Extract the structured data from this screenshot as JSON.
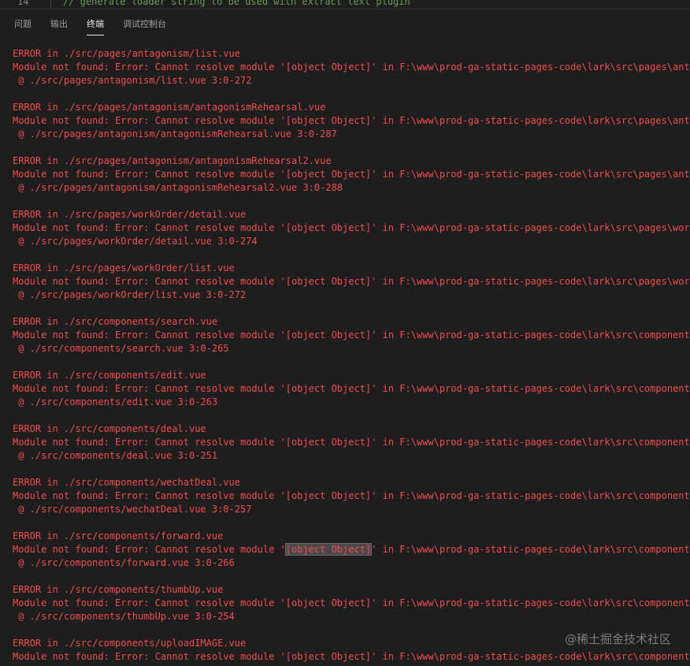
{
  "editor": {
    "line_number": "14",
    "code_text": "// generate loader string to be used with extract text plugin"
  },
  "panel": {
    "tabs": [
      {
        "label": "问题"
      },
      {
        "label": "输出"
      },
      {
        "label": "终端"
      },
      {
        "label": "调试控制台"
      }
    ],
    "active_tab": "终端"
  },
  "terminal": {
    "blocks": [
      {
        "error": "ERROR in ./src/pages/antagonism/list.vue",
        "message": "Module not found: Error: Cannot resolve module '[object Object]' in F:\\www\\prod-ga-static-pages-code\\lark\\src\\pages\\antagonism",
        "at": " @ ./src/pages/antagonism/list.vue 3:0-272"
      },
      {
        "error": "ERROR in ./src/pages/antagonism/antagonismRehearsal.vue",
        "message": "Module not found: Error: Cannot resolve module '[object Object]' in F:\\www\\prod-ga-static-pages-code\\lark\\src\\pages\\antagonism",
        "at": " @ ./src/pages/antagonism/antagonismRehearsal.vue 3:0-287"
      },
      {
        "error": "ERROR in ./src/pages/antagonism/antagonismRehearsal2.vue",
        "message": "Module not found: Error: Cannot resolve module '[object Object]' in F:\\www\\prod-ga-static-pages-code\\lark\\src\\pages\\antagonism",
        "at": " @ ./src/pages/antagonism/antagonismRehearsal2.vue 3:0-288"
      },
      {
        "error": "ERROR in ./src/pages/workOrder/detail.vue",
        "message": "Module not found: Error: Cannot resolve module '[object Object]' in F:\\www\\prod-ga-static-pages-code\\lark\\src\\pages\\workOrder",
        "at": " @ ./src/pages/workOrder/detail.vue 3:0-274"
      },
      {
        "error": "ERROR in ./src/pages/workOrder/list.vue",
        "message": "Module not found: Error: Cannot resolve module '[object Object]' in F:\\www\\prod-ga-static-pages-code\\lark\\src\\pages\\workOrder",
        "at": " @ ./src/pages/workOrder/list.vue 3:0-272"
      },
      {
        "error": "ERROR in ./src/components/search.vue",
        "message": "Module not found: Error: Cannot resolve module '[object Object]' in F:\\www\\prod-ga-static-pages-code\\lark\\src\\components",
        "at": " @ ./src/components/search.vue 3:0-265"
      },
      {
        "error": "ERROR in ./src/components/edit.vue",
        "message": "Module not found: Error: Cannot resolve module '[object Object]' in F:\\www\\prod-ga-static-pages-code\\lark\\src\\components",
        "at": " @ ./src/components/edit.vue 3:0-263"
      },
      {
        "error": "ERROR in ./src/components/deal.vue",
        "message": "Module not found: Error: Cannot resolve module '[object Object]' in F:\\www\\prod-ga-static-pages-code\\lark\\src\\components",
        "at": " @ ./src/components/deal.vue 3:0-251"
      },
      {
        "error": "ERROR in ./src/components/wechatDeal.vue",
        "message": "Module not found: Error: Cannot resolve module '[object Object]' in F:\\www\\prod-ga-static-pages-code\\lark\\src\\components",
        "at": " @ ./src/components/wechatDeal.vue 3:0-257"
      },
      {
        "error": "ERROR in ./src/components/forward.vue",
        "message": "Module not found: Error: Cannot resolve module '[object Object]' in F:\\www\\prod-ga-static-pages-code\\lark\\src\\components",
        "at": " @ ./src/components/forward.vue 3:0-266",
        "highlight": "[object Object]"
      },
      {
        "error": "ERROR in ./src/components/thumbUp.vue",
        "message": "Module not found: Error: Cannot resolve module '[object Object]' in F:\\www\\prod-ga-static-pages-code\\lark\\src\\components",
        "at": " @ ./src/components/thumbUp.vue 3:0-254"
      },
      {
        "error": "ERROR in ./src/components/uploadIMAGE.vue",
        "message": "Module not found: Error: Cannot resolve module '[object Object]' in F:\\www\\prod-ga-static-pages-code\\lark\\src\\components",
        "at": ""
      }
    ]
  },
  "watermark": "@稀土掘金技术社区",
  "colors": {
    "background": "#1e1e1e",
    "error_text": "#f14c4c",
    "comment": "#6a9955",
    "tab_active": "#e7e7e7",
    "tab_inactive": "#9d9d9d"
  }
}
